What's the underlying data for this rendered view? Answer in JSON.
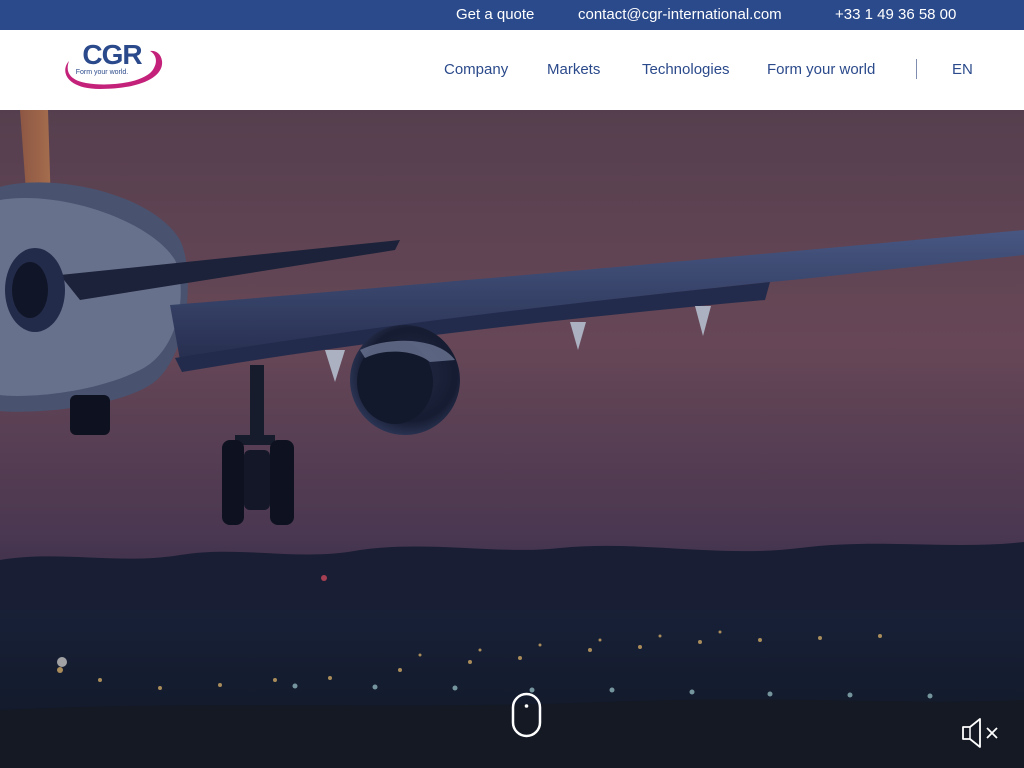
{
  "topbar": {
    "quote_label": "Get a quote",
    "email": "contact@cgr-international.com",
    "phone": "+33 1 49 36 58 00"
  },
  "header": {
    "logo": {
      "brand": "CGR",
      "tagline": "Form your world."
    },
    "nav": {
      "company": "Company",
      "markets": "Markets",
      "technologies": "Technologies",
      "form_your_world": "Form your world"
    },
    "language": "EN"
  },
  "hero": {
    "scene": "airplane-landing-at-dusk",
    "icons": {
      "scroll": "mouse-scroll-icon",
      "audio": "speaker-muted-icon"
    }
  },
  "colors": {
    "brand_blue": "#2b4a8b",
    "brand_magenta": "#c4227a",
    "topbar_bg": "#2b4a8b",
    "header_bg": "#ffffff"
  }
}
